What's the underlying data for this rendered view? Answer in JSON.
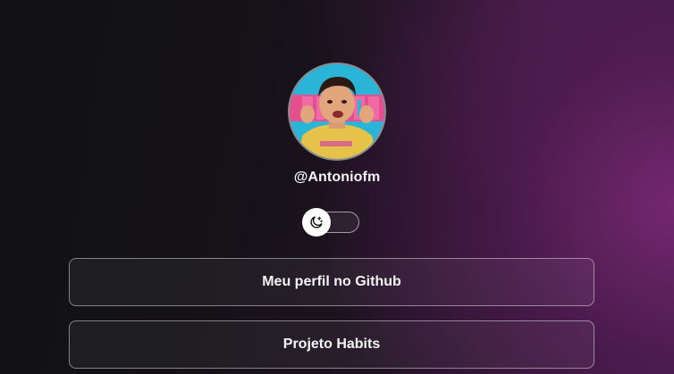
{
  "profile": {
    "username": "@Antoniofm",
    "avatar_alt": "avatar-photo"
  },
  "theme_switch": {
    "icon": "moon-stars-icon",
    "state": "dark"
  },
  "links": [
    {
      "label": "Meu perfil no Github"
    },
    {
      "label": "Projeto Habits"
    }
  ],
  "colors": {
    "background_dark": "#111113",
    "background_accent": "#7e2a78",
    "text": "#f4f4f5",
    "border": "#8a8a8f"
  }
}
